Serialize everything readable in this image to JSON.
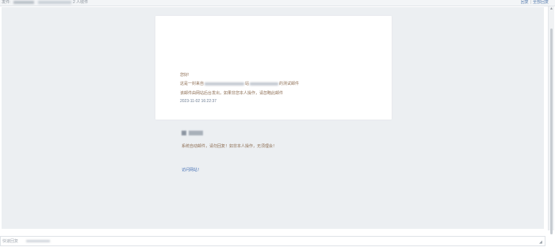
{
  "header": {
    "from_label": "发件:",
    "to_tail": "2 人收件",
    "actions": [
      "回复",
      "全部回复"
    ]
  },
  "email": {
    "greeting": "您好!",
    "line1_prefix": "这是一封来自",
    "line1_mid": "站",
    "line1_suffix": "的测试邮件",
    "line2": "该邮件由网站后台发出，如果非您本人操作，请忽略此邮件",
    "timestamp": "2023-11-02 16:22:37",
    "notice": "系统自动邮件，请勿回复！如非本人操作，无须理会！",
    "link_text": "访问网站！"
  },
  "reply": {
    "placeholder": "快速回复"
  },
  "colors": {
    "mail_background": "#eceff2",
    "body_text": "#8e6f55",
    "link": "#4a74b7"
  }
}
